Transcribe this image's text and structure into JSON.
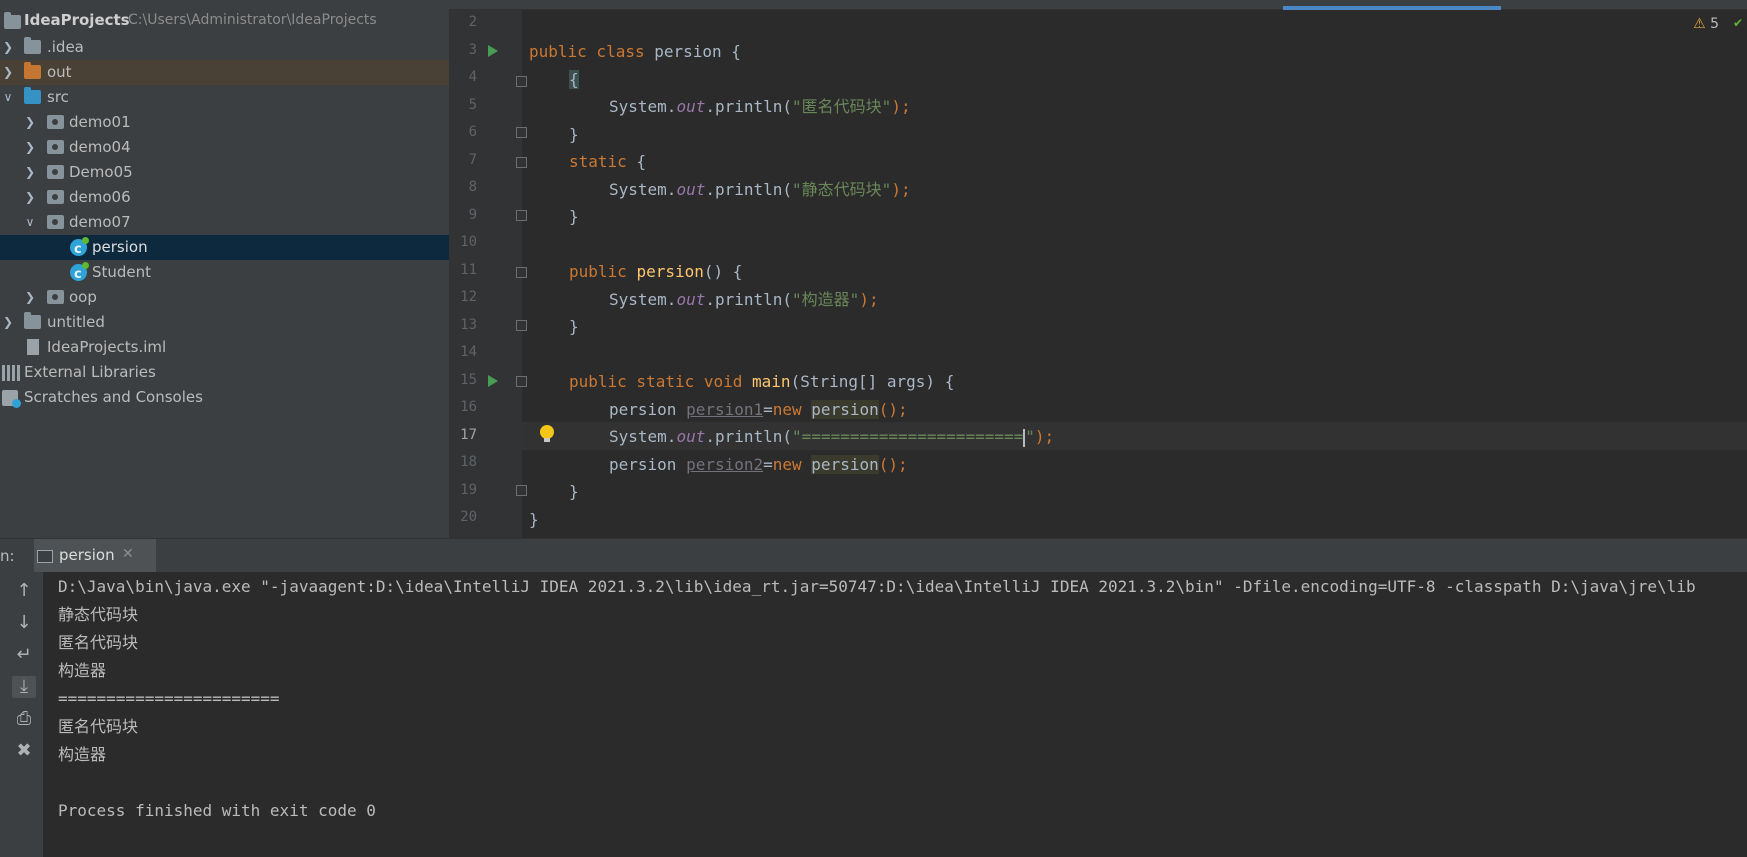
{
  "project_tree": {
    "root": {
      "label": "IdeaProjects",
      "path": "C:\\Users\\Administrator\\IdeaProjects"
    },
    "items": [
      {
        "label": ".idea",
        "expanded": false
      },
      {
        "label": "out",
        "expanded": false
      },
      {
        "label": "src",
        "expanded": true
      },
      {
        "label": "demo01",
        "expanded": false
      },
      {
        "label": "demo04",
        "expanded": false
      },
      {
        "label": "Demo05",
        "expanded": false
      },
      {
        "label": "demo06",
        "expanded": false
      },
      {
        "label": "demo07",
        "expanded": true
      },
      {
        "label": "persion",
        "selected": true
      },
      {
        "label": "Student"
      },
      {
        "label": "oop",
        "expanded": false
      },
      {
        "label": "untitled",
        "expanded": false
      },
      {
        "label": "IdeaProjects.iml"
      },
      {
        "label": "External Libraries"
      },
      {
        "label": "Scratches and Consoles"
      }
    ]
  },
  "editor": {
    "line_numbers": [
      "2",
      "3",
      "4",
      "5",
      "6",
      "7",
      "8",
      "9",
      "10",
      "11",
      "12",
      "13",
      "14",
      "15",
      "16",
      "17",
      "18",
      "19",
      "20"
    ],
    "current_line": "17",
    "inspection_count": "5",
    "code": {
      "l3": {
        "kw": "public class ",
        "name": "persion",
        "rest": " {"
      },
      "l4": "{",
      "l5": {
        "a": "System.",
        "fld": "out",
        "b": ".println(",
        "str": "\"匿名代码块\"",
        "c": ");"
      },
      "l6": "}",
      "l7": {
        "kw": "static",
        "rest": " {"
      },
      "l8": {
        "a": "System.",
        "fld": "out",
        "b": ".println(",
        "str": "\"静态代码块\"",
        "c": ");"
      },
      "l9": "}",
      "l11": {
        "kw": "public ",
        "fn": "persion",
        "rest": "() {"
      },
      "l12": {
        "a": "System.",
        "fld": "out",
        "b": ".println(",
        "str": "\"构造器\"",
        "c": ");"
      },
      "l13": "}",
      "l15": {
        "kw": "public static void ",
        "fn": "main",
        "rest": "(String[] args) {"
      },
      "l16": {
        "type": "persion ",
        "var": "persion1",
        "eq": "=",
        "kw": "new ",
        "cls": "persion",
        "end": "();"
      },
      "l17": {
        "a": "System.",
        "fld": "out",
        "b": ".println(",
        "str": "\"=======================",
        "str2": "\"",
        "c": ");"
      },
      "l18": {
        "type": "persion ",
        "var": "persion2",
        "eq": "=",
        "kw": "new ",
        "cls": "persion",
        "end": "();"
      },
      "l19": "}",
      "l20": "}"
    }
  },
  "run": {
    "label": "n:",
    "tab_label": "persion",
    "console": [
      "D:\\Java\\bin\\java.exe \"-javaagent:D:\\idea\\IntelliJ IDEA 2021.3.2\\lib\\idea_rt.jar=50747:D:\\idea\\IntelliJ IDEA 2021.3.2\\bin\" -Dfile.encoding=UTF-8 -classpath D:\\java\\jre\\lib",
      "静态代码块",
      "匿名代码块",
      "构造器",
      "=======================",
      "匿名代码块",
      "构造器",
      "",
      "Process finished with exit code 0"
    ]
  },
  "colors": {
    "tree_bg": "#3c3f41",
    "editor_bg": "#2b2b2b",
    "keyword": "#cc7832",
    "string": "#6a8759",
    "function": "#ffc66d",
    "field": "#9876aa",
    "selection": "#0d293e"
  }
}
